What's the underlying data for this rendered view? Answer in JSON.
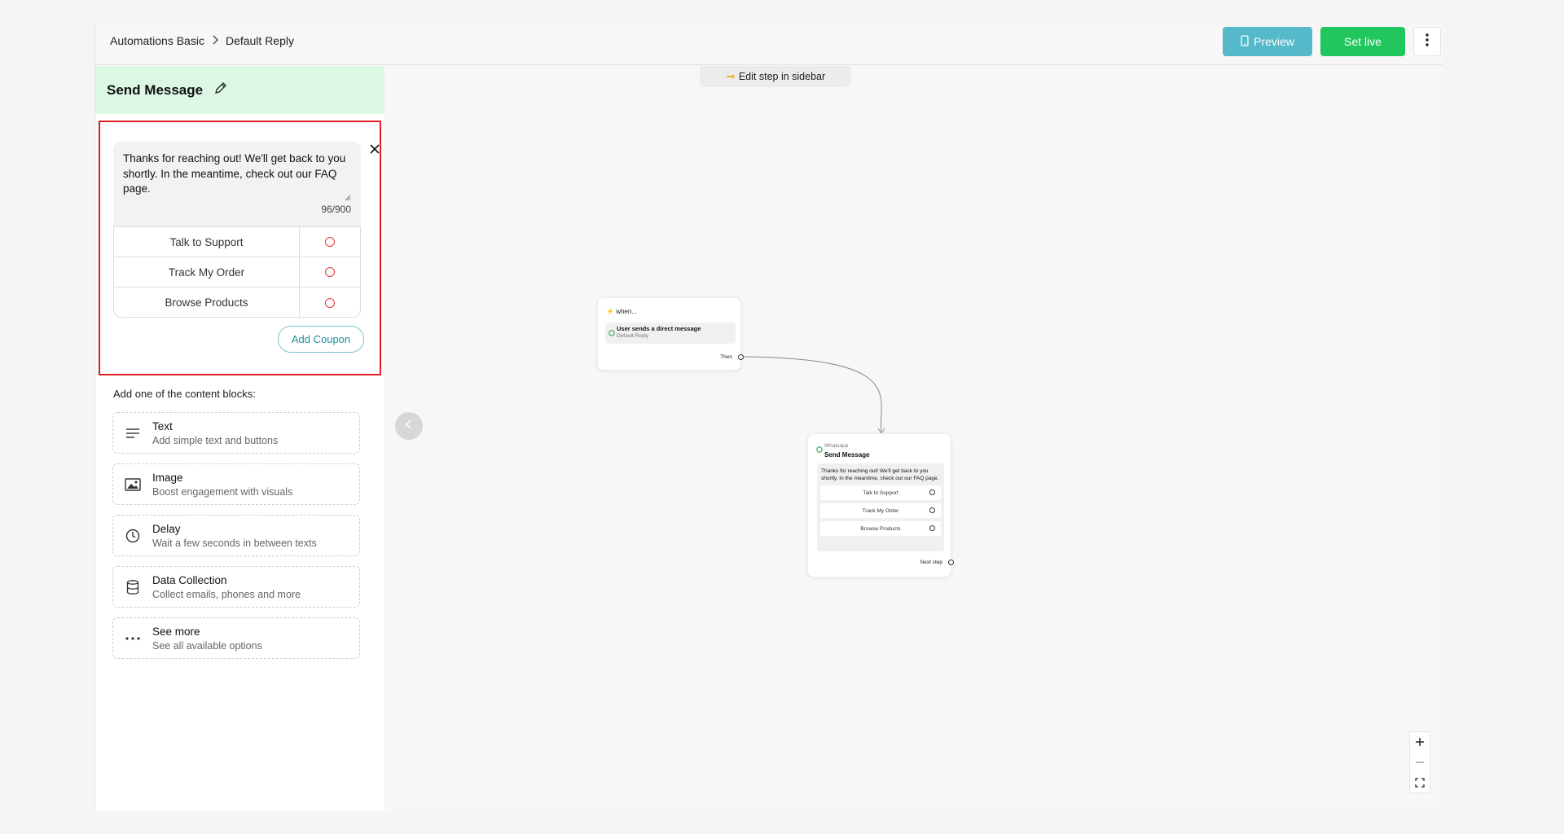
{
  "header": {
    "breadcrumb": [
      "Automations Basic",
      "Default Reply"
    ],
    "preview_label": "Preview",
    "set_live_label": "Set live"
  },
  "sidebar": {
    "title": "Send Message",
    "message_text": "Thanks for reaching out! We'll get back to you shortly. In the meantime, check out our FAQ page.",
    "char_count": "96/900",
    "buttons": [
      "Talk to Support",
      "Track My Order",
      "Browse Products"
    ],
    "add_coupon_label": "Add Coupon",
    "blocks_title": "Add one of the content blocks:",
    "blocks": [
      {
        "title": "Text",
        "desc": "Add simple text and buttons",
        "icon": "text-lines-icon"
      },
      {
        "title": "Image",
        "desc": "Boost engagement with visuals",
        "icon": "image-icon"
      },
      {
        "title": "Delay",
        "desc": "Wait a few seconds in between texts",
        "icon": "clock-icon"
      },
      {
        "title": "Data Collection",
        "desc": "Collect emails, phones and more",
        "icon": "database-icon"
      },
      {
        "title": "See more",
        "desc": "See all available options",
        "icon": "ellipsis-icon"
      }
    ]
  },
  "canvas": {
    "hint": "Edit step in sidebar",
    "trigger_node": {
      "when": "when...",
      "trigger": "User sends a direct message",
      "sub": "Default Reply",
      "then": "Then"
    },
    "message_node": {
      "source": "Whatsapp",
      "name": "Send Message",
      "text": "Thanks for reaching out! We'll get back to you shortly. In the meantime, check out our FAQ page.",
      "buttons": [
        "Talk to Support",
        "Track My Order",
        "Browse Products"
      ],
      "next": "Next step"
    }
  },
  "colors": {
    "preview": "#55b9c9",
    "set_live": "#22c65e",
    "sidebar_header": "#dcf7e3",
    "highlight": "#e01c24",
    "coupon": "#1e8f9c"
  }
}
